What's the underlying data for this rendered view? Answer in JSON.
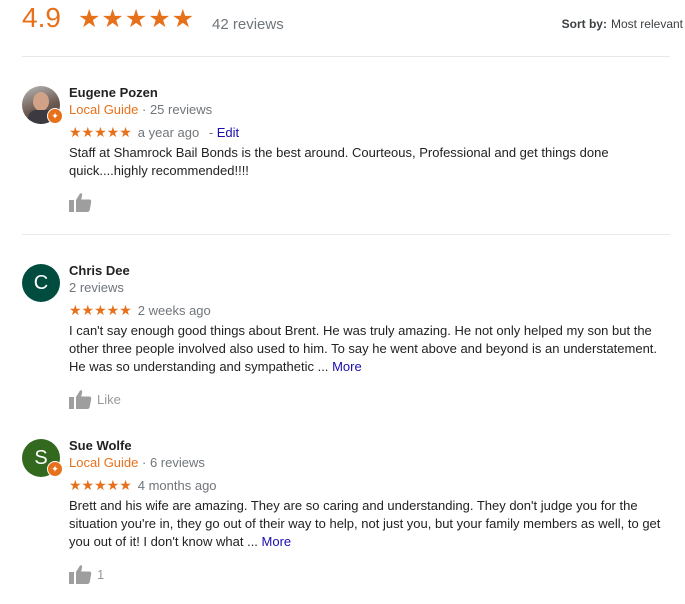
{
  "header": {
    "rating": "4.9",
    "stars": "★★★★★",
    "review_count": "42 reviews",
    "sort_label": "Sort by:",
    "sort_value": "Most relevant"
  },
  "reviews": [
    {
      "name": "Eugene Pozen",
      "local_guide": "Local Guide",
      "meta_sep": " · ",
      "review_count": "25 reviews",
      "stars": "★★★★★",
      "rating": 5,
      "time": "a year ago",
      "edit_sep": " - ",
      "edit": "Edit",
      "text": "Staff at Shamrock Bail Bonds is the best around. Courteous, Professional and get things done quick....highly recommended!!!!",
      "like_label": ""
    },
    {
      "initial": "C",
      "name": "Chris Dee",
      "review_count": "2 reviews",
      "stars": "★★★★★",
      "rating": 5,
      "time": "2 weeks ago",
      "text": "I can't say enough good things about Brent. He was truly amazing. He not only helped my son but the other three people involved also used to him. To say he went above and beyond is an understatement. He was so understanding and sympathetic ...",
      "more": "More",
      "like_label": "Like"
    },
    {
      "initial": "S",
      "name": "Sue Wolfe",
      "local_guide": "Local Guide",
      "meta_sep": " · ",
      "review_count": "6 reviews",
      "stars": "★★★★★",
      "rating": 5,
      "time": "4 months ago",
      "text": "Brett and his wife are amazing. They are so caring and understanding. They don't judge you for the situation you're in, they go out of their way to help, not just you, but your family members as well, to get you out of it! I don't know what ...",
      "more": "More",
      "like_label": "1"
    }
  ],
  "colors": {
    "accent": "#e7711b",
    "link": "#1a0dab",
    "avatar_c": "#004d40",
    "avatar_s": "#33691e"
  },
  "icons": {
    "star": "star-icon",
    "thumb": "thumbs-up-icon",
    "guide": "local-guide-badge-icon"
  }
}
